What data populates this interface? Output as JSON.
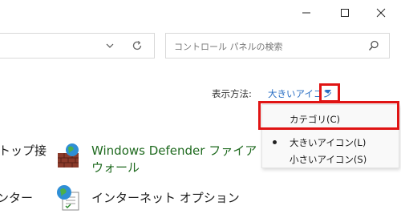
{
  "window": {
    "controls": [
      "minimize",
      "maximize",
      "close"
    ]
  },
  "search": {
    "placeholder": "コントロール パネルの検索"
  },
  "view": {
    "label": "表示方法:",
    "value": "大きいアイコン"
  },
  "menu": {
    "items": [
      {
        "label": "カテゴリ(C)",
        "selected": false
      },
      {
        "label": "大きいアイコン(L)",
        "selected": true
      },
      {
        "label": "小さいアイコン(S)",
        "selected": false
      }
    ]
  },
  "items": {
    "left_partial_1": "トップ接",
    "left_partial_2": "ンター",
    "firewall_line1": "Windows Defender ファイア",
    "firewall_line2": "ウォール",
    "internet_options": "インターネット オプション"
  },
  "colors": {
    "highlight": "#e01414",
    "link_blue": "#2a6fc4",
    "item_green": "#1f6a1f"
  }
}
